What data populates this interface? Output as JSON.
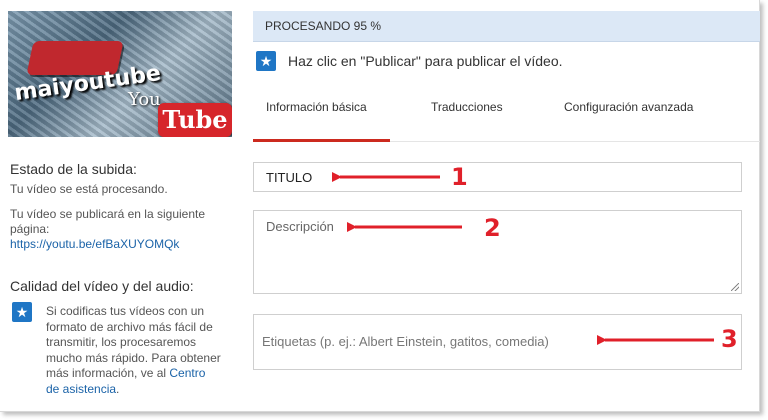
{
  "colors": {
    "accent_blue": "#1f76c5",
    "link_blue": "#1b63a8",
    "status_bg": "#dce8f6",
    "tab_active": "#cc2a1f",
    "annotation_red": "#e0202a"
  },
  "thumbnail": {
    "overlay_text_you": "You",
    "overlay_text_tube": "Tube",
    "overlay_text_channel": "maiyoutube"
  },
  "upload_status": {
    "heading": "Estado de la subida:",
    "processing_text": "Tu vídeo se está procesando.",
    "publish_text": "Tu vídeo se publicará en la siguiente página:",
    "link": "https://youtu.be/efBaXUYOMQk"
  },
  "quality": {
    "heading": "Calidad del vídeo y del audio:",
    "icon": "star-icon",
    "text": "Si codificas tus vídeos con un formato de archivo más fácil de transmitir, los procesaremos mucho más rápido. Para obtener más información, ve al ",
    "link_text": "Centro de asistencia",
    "trailing": "."
  },
  "status_bar": {
    "label": "PROCESANDO 95 %",
    "progress_percent": 95
  },
  "publish_hint": {
    "icon": "star-icon",
    "text": "Haz clic en \"Publicar\" para publicar el vídeo."
  },
  "tabs": [
    {
      "label": "Información básica",
      "active": true
    },
    {
      "label": "Traducciones",
      "active": false
    },
    {
      "label": "Configuración avanzada",
      "active": false
    }
  ],
  "form": {
    "title_value": "TITULO",
    "description_placeholder": "Descripción",
    "tags_placeholder": "Etiquetas (p. ej.: Albert Einstein, gatitos, comedia)"
  },
  "annotations": [
    "1",
    "2",
    "3"
  ]
}
